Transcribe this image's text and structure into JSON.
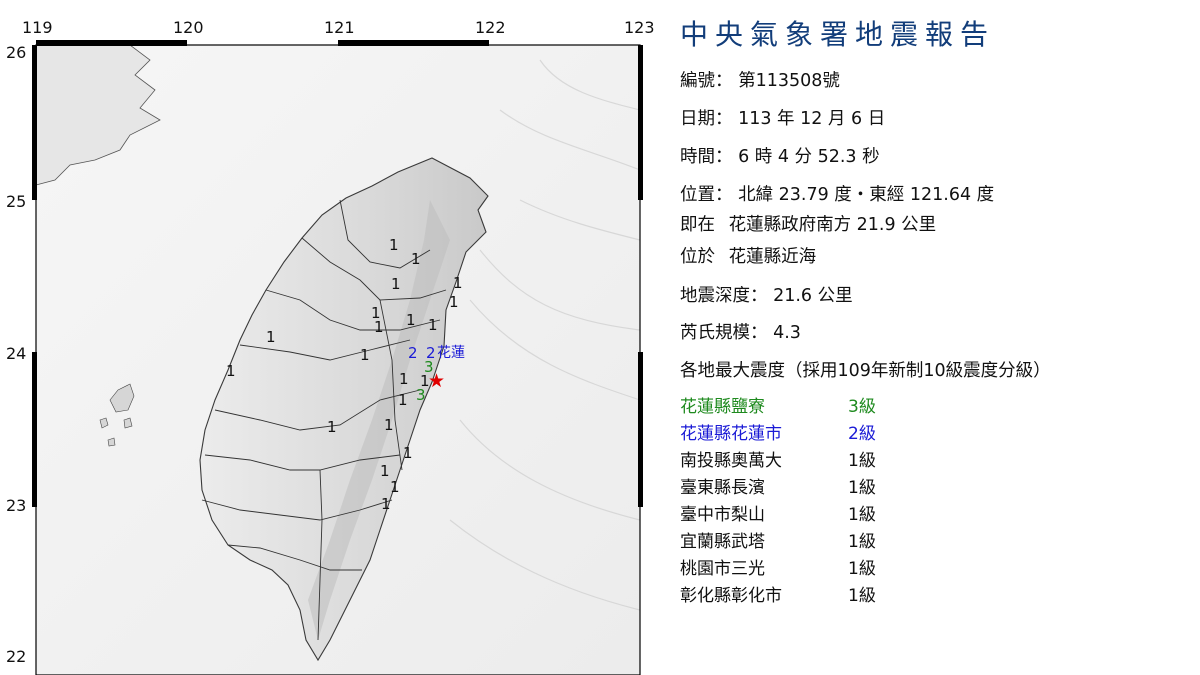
{
  "map": {
    "longitude_ticks": [
      "119",
      "120",
      "121",
      "122",
      "123"
    ],
    "latitude_ticks": [
      "26",
      "25",
      "24",
      "23",
      "22"
    ],
    "intensity_labels": [
      {
        "text": "1",
        "color": "#111111"
      },
      {
        "text": "1",
        "color": "#111111"
      },
      {
        "text": "1",
        "color": "#111111"
      },
      {
        "text": "1",
        "color": "#111111"
      },
      {
        "text": "1",
        "color": "#111111"
      },
      {
        "text": "1",
        "color": "#111111"
      },
      {
        "text": "1",
        "color": "#111111"
      },
      {
        "text": "1",
        "color": "#111111"
      },
      {
        "text": "1",
        "color": "#111111"
      },
      {
        "text": "1",
        "color": "#111111"
      },
      {
        "text": "1",
        "color": "#111111"
      },
      {
        "text": "1",
        "color": "#111111"
      },
      {
        "text": "2",
        "color": "#1a1ad6"
      },
      {
        "text": "2",
        "color": "#1a1ad6"
      },
      {
        "text": "3",
        "color": "#1e8a1e"
      },
      {
        "text": "1",
        "color": "#111111"
      },
      {
        "text": "1",
        "color": "#111111"
      },
      {
        "text": "1",
        "color": "#111111"
      },
      {
        "text": "3",
        "color": "#1e8a1e"
      },
      {
        "text": "1",
        "color": "#111111"
      },
      {
        "text": "1",
        "color": "#111111"
      },
      {
        "text": "1",
        "color": "#111111"
      },
      {
        "text": "1",
        "color": "#111111"
      },
      {
        "text": "1",
        "color": "#111111"
      },
      {
        "text": "1",
        "color": "#111111"
      },
      {
        "text": "1",
        "color": "#111111"
      }
    ],
    "place_label": "花蓮",
    "place_label_color": "#1a1ad6",
    "epicenter_symbol": "★",
    "epicenter_color": "#e00000"
  },
  "report": {
    "title": "中央氣象署地震報告",
    "number_label": "編號：",
    "number_value": "第113508號",
    "date_label": "日期：",
    "date_value": "113 年 12 月 6 日",
    "time_label": "時間：",
    "time_value": "6 時 4 分 52.3 秒",
    "location_label": "位置：",
    "location_value": "北緯 23.79 度・東經 121.64 度",
    "at_label": "即在",
    "at_value": "花蓮縣政府南方 21.9 公里",
    "located_label": "位於",
    "located_value": "花蓮縣近海",
    "depth_label": "地震深度：",
    "depth_value": "21.6 公里",
    "magnitude_label": "芮氏規模：",
    "magnitude_value": "4.3",
    "intensity_heading": "各地最大震度（採用109年新制10級震度分級）",
    "stations": [
      {
        "name": "花蓮縣鹽寮",
        "intensity": "3級",
        "color": "#1e8a1e"
      },
      {
        "name": "花蓮縣花蓮市",
        "intensity": "2級",
        "color": "#1a1ad6"
      },
      {
        "name": "南投縣奧萬大",
        "intensity": "1級",
        "color": "#111111"
      },
      {
        "name": "臺東縣長濱",
        "intensity": "1級",
        "color": "#111111"
      },
      {
        "name": "臺中市梨山",
        "intensity": "1級",
        "color": "#111111"
      },
      {
        "name": "宜蘭縣武塔",
        "intensity": "1級",
        "color": "#111111"
      },
      {
        "name": "桃園市三光",
        "intensity": "1級",
        "color": "#111111"
      },
      {
        "name": "彰化縣彰化市",
        "intensity": "1級",
        "color": "#111111"
      }
    ]
  }
}
